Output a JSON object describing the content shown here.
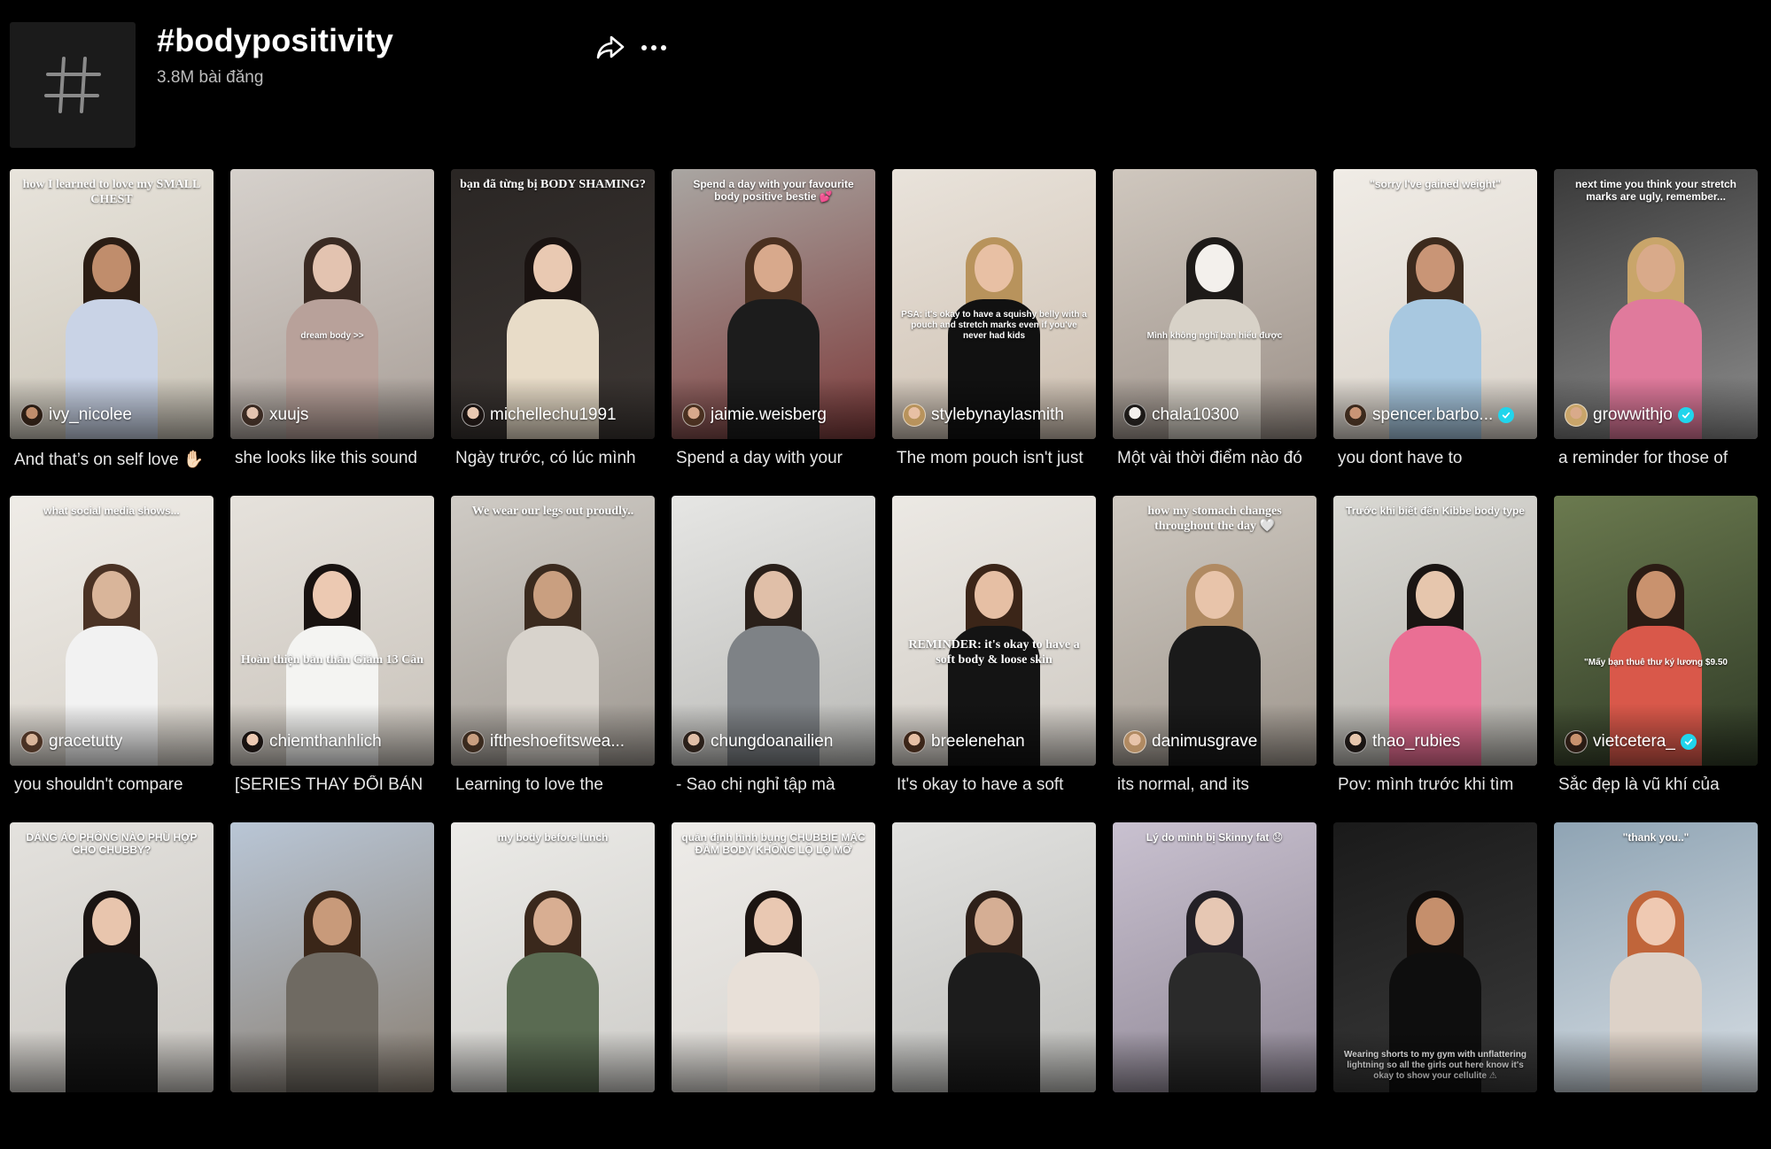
{
  "hashtag": {
    "title": "#bodypositivity",
    "count": "3.8M bài đăng"
  },
  "icons": {
    "hashtag": "hash-icon",
    "share": "share-arrow-icon",
    "more": "ellipsis-icon",
    "verified": "verified-check-icon"
  },
  "colors": {
    "background": "#000000",
    "tile": "#1b1b1b",
    "verified": "#20d5ec"
  },
  "videos": [
    {
      "username": "ivy_nicolee",
      "verified": false,
      "caption": "And that’s on self love ✋🏻",
      "overlay": "how I learned to love my SMALL CHEST",
      "overlay_style": "serif",
      "bg": [
        "#e8e4dc",
        "#c9c3b6"
      ],
      "skin": "#c08d6c",
      "hair": "#2b1d14",
      "top": "#c9d3e6"
    },
    {
      "username": "xuujs",
      "verified": false,
      "caption": "she looks like this sound",
      "overlay": "dream body >>",
      "overlay_style": "mid",
      "bg": [
        "#d6d1cc",
        "#a99f98"
      ],
      "skin": "#e3c3b0",
      "hair": "#3a2a22",
      "top": "#b8a19a"
    },
    {
      "username": "michellechu1991",
      "verified": false,
      "caption": "Ngày trước, có lúc mình",
      "overlay": "bạn đã từng bị BODY SHAMING?",
      "overlay_style": "serif",
      "bg": [
        "#2a2624",
        "#3d3734"
      ],
      "skin": "#e9c9b2",
      "hair": "#1a1311",
      "top": "#e8dcc8"
    },
    {
      "username": "jaimie.weisberg",
      "verified": false,
      "caption": "Spend a day with your",
      "overlay": "Spend a day with your favourite body positive bestie 💕",
      "overlay_style": "",
      "bg": [
        "#a9a6a2",
        "#7d3b3b"
      ],
      "skin": "#d8a98c",
      "hair": "#4a3020",
      "top": "#1c1c1c"
    },
    {
      "username": "stylebynaylasmith",
      "verified": false,
      "caption": "The mom pouch isn't just",
      "overlay": "PSA: it's okay to have a squishy belly with a pouch and stretch marks even if you've never had kids",
      "overlay_style": "mid",
      "bg": [
        "#e9e3db",
        "#cdbfb0"
      ],
      "skin": "#e8c0a4",
      "hair": "#b8935c",
      "top": "#111111"
    },
    {
      "username": "chala10300",
      "verified": false,
      "caption": "Một vài thời điểm nào đó",
      "overlay": "Mình không nghĩ bạn hiểu được",
      "overlay_style": "mid",
      "bg": [
        "#cfc7be",
        "#9c9189"
      ],
      "skin": "#f3f0ec",
      "hair": "#1d1a18",
      "top": "#d8d2c8"
    },
    {
      "username": "spencer.barbo...",
      "verified": true,
      "caption": "you dont have to",
      "overlay": "\"sorry I've gained weight\"",
      "overlay_style": "",
      "bg": [
        "#f0ece6",
        "#d9d2c9"
      ],
      "skin": "#c99576",
      "hair": "#3c2a1d",
      "top": "#a8c8e0"
    },
    {
      "username": "growwithjo",
      "verified": true,
      "caption": "a reminder for those of",
      "overlay": "next time you think your stretch marks are ugly, remember...",
      "overlay_style": "",
      "bg": [
        "#3a3a3a",
        "#8c8c8c"
      ],
      "skin": "#d9aa8a",
      "hair": "#c9a56a",
      "top": "#e07a9c"
    },
    {
      "username": "gracetutty",
      "verified": false,
      "caption": "you shouldn't compare",
      "overlay": "what social media shows...",
      "overlay_style": "",
      "bg": [
        "#efece7",
        "#d6d1c9"
      ],
      "skin": "#d9b59a",
      "hair": "#4a3224",
      "top": "#f2f2f2"
    },
    {
      "username": "chiemthanhlich",
      "verified": false,
      "caption": "[SERIES THAY ĐỔI BẢN",
      "overlay": "Hoàn thiện bản thân Giảm 13 Cân",
      "overlay_style": "serif-mid",
      "bg": [
        "#e6e2dc",
        "#c8c2ba"
      ],
      "skin": "#ecc9b2",
      "hair": "#181210",
      "top": "#f4f4f2"
    },
    {
      "username": "iftheshoefitswea...",
      "verified": false,
      "caption": "Learning to love the",
      "overlay": "We wear our legs out proudly..",
      "overlay_style": "serif",
      "bg": [
        "#cfcbc5",
        "#9e9891"
      ],
      "skin": "#c99f80",
      "hair": "#3a2a1e",
      "top": "#d8d3cc"
    },
    {
      "username": "chungdoanailien",
      "verified": false,
      "caption": "- Sao chị nghỉ tập mà",
      "overlay": "",
      "overlay_style": "",
      "bg": [
        "#e6e6e4",
        "#b9b9b6"
      ],
      "skin": "#e0bfa8",
      "hair": "#2a201a",
      "top": "#7e8286"
    },
    {
      "username": "breelenehan",
      "verified": false,
      "caption": "It's okay to have a soft",
      "overlay": "REMINDER: it's okay to have a soft body & loose skin",
      "overlay_style": "serif-mid",
      "bg": [
        "#ece9e4",
        "#cfcac3"
      ],
      "skin": "#e6bfa4",
      "hair": "#3b2518",
      "top": "#141414"
    },
    {
      "username": "danimusgrave",
      "verified": false,
      "caption": "its normal, and its",
      "overlay": "how my stomach changes throughout the day 🤍",
      "overlay_style": "serif",
      "bg": [
        "#cfc9c1",
        "#9f978e"
      ],
      "skin": "#e8c4aa",
      "hair": "#b08a62",
      "top": "#1a1a1a"
    },
    {
      "username": "thao_rubies",
      "verified": false,
      "caption": "Pov: mình trước khi tìm",
      "overlay": "Trước khi biết đến Kibbe body type",
      "overlay_style": "",
      "bg": [
        "#d9d8d3",
        "#b2b0aa"
      ],
      "skin": "#e6c6ad",
      "hair": "#1a1513",
      "top": "#ea6f94"
    },
    {
      "username": "vietcetera_",
      "verified": true,
      "caption": "Sắc đẹp là vũ khí của",
      "overlay": "\"Mấy bạn thuê thư ký lương $9.50",
      "overlay_style": "mid",
      "bg": [
        "#6b7a4f",
        "#2f3a26"
      ],
      "skin": "#c9926e",
      "hair": "#2b1c14",
      "top": "#d9584a"
    },
    {
      "username": "",
      "verified": false,
      "caption": "",
      "overlay": "DÁNG ÁO PHÔNG NÀO PHÙ HỢP CHO CHUBBY?",
      "overlay_style": "",
      "bg": [
        "#e4e2de",
        "#c8c5c0"
      ],
      "skin": "#e8c5ad",
      "hair": "#1a1412",
      "top": "#161616"
    },
    {
      "username": "",
      "verified": false,
      "caption": "",
      "overlay": "",
      "overlay_style": "",
      "bg": [
        "#b9c6d6",
        "#8a7f72"
      ],
      "skin": "#c89a7a",
      "hair": "#3a2618",
      "top": "#6f6a62"
    },
    {
      "username": "",
      "verified": false,
      "caption": "",
      "overlay": "my body before lunch",
      "overlay_style": "",
      "bg": [
        "#ecebe8",
        "#cdccc8"
      ],
      "skin": "#d8ae92",
      "hair": "#3a281c",
      "top": "#5a6b52"
    },
    {
      "username": "",
      "verified": false,
      "caption": "",
      "overlay": "quản định hình bụng CHUBBIE MẶC ĐẦM BODY KHÔNG LỘ LỘ MỠ",
      "overlay_style": "",
      "bg": [
        "#eeece9",
        "#d6d3ce"
      ],
      "skin": "#e9c8b2",
      "hair": "#1c1512",
      "top": "#e8e0d8"
    },
    {
      "username": "",
      "verified": false,
      "caption": "",
      "overlay": "",
      "overlay_style": "",
      "bg": [
        "#e2e2e0",
        "#bdbdba"
      ],
      "skin": "#d5ae94",
      "hair": "#2e2019",
      "top": "#1c1c1c"
    },
    {
      "username": "",
      "verified": false,
      "caption": "",
      "overlay": "Lý do mình bị Skinny fat 😞",
      "overlay_style": "",
      "bg": [
        "#c9c1d0",
        "#8f8795"
      ],
      "skin": "#e6c7b3",
      "hair": "#232026",
      "top": "#2a2a2a"
    },
    {
      "username": "",
      "verified": false,
      "caption": "",
      "overlay": "Wearing shorts to my gym with unflattering lightning so all the girls out here know it's okay to show your cellulite ⚠",
      "overlay_style": "bottom",
      "bg": [
        "#1a1a1a",
        "#3a3a3a"
      ],
      "skin": "#c58f6c",
      "hair": "#120e0c",
      "top": "#0e0e0e"
    },
    {
      "username": "",
      "verified": false,
      "caption": "",
      "overlay": "\"thank you..\"",
      "overlay_style": "",
      "bg": [
        "#8fa4b4",
        "#d6dde3"
      ],
      "skin": "#efc9b2",
      "hair": "#c0653a",
      "top": "#ddd2c8"
    }
  ]
}
